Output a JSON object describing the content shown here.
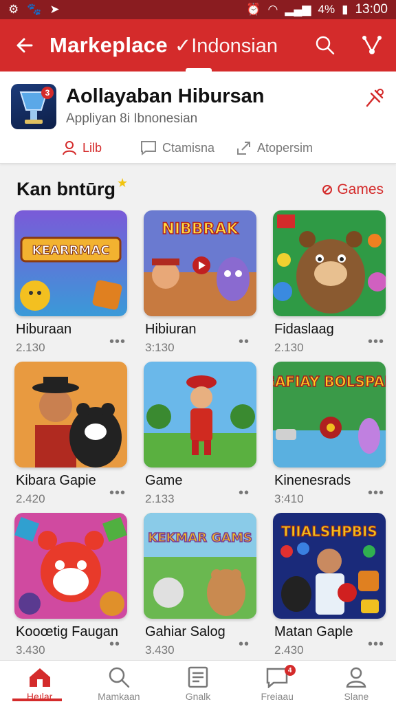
{
  "status_bar": {
    "battery": "4%",
    "time": "13:00"
  },
  "app_bar": {
    "title": "Markeplace",
    "subtitle": "✓Indonsian"
  },
  "header": {
    "app_name": "Aollayaban Hibursan",
    "app_sub": "Appliyan 8i Ibnonesian",
    "icon_badge": "3",
    "actions": [
      {
        "label": "Lilb"
      },
      {
        "label": "Ctamisna"
      },
      {
        "label": "Atopersim"
      }
    ]
  },
  "section": {
    "title": "Kan bntūrg",
    "link": "Games"
  },
  "tiles": [
    {
      "name": "Hiburaan",
      "count": "2.130",
      "art_text": "KEARRMAC"
    },
    {
      "name": "Hibiuran",
      "count": "3:130",
      "art_text": "NIBBRAK"
    },
    {
      "name": "Fidaslaag",
      "count": "2.130",
      "art_text": ""
    },
    {
      "name": "Kibara Gapie",
      "count": "2.420",
      "art_text": ""
    },
    {
      "name": "Game",
      "count": "2.133",
      "art_text": ""
    },
    {
      "name": "Kinenesrads",
      "count": "3:410",
      "art_text": "GAFIAY BOLSPAK"
    },
    {
      "name": "Kooœtig Faugan",
      "count": "3.430",
      "art_text": ""
    },
    {
      "name": "Gahiar Salog",
      "count": "3.430",
      "art_text": "KEKMAR GAMS"
    },
    {
      "name": "Matan Gaple",
      "count": "2.430",
      "art_text": "TIIALSHPBIS"
    }
  ],
  "bottom_nav": [
    {
      "label": "Heılar",
      "active": true
    },
    {
      "label": "Mamkaan"
    },
    {
      "label": "Gnalk"
    },
    {
      "label": "Freiaau",
      "badge": "4"
    },
    {
      "label": "Slane"
    }
  ],
  "colors": {
    "brand": "#d42b2b",
    "status_bar": "#8a1c20"
  }
}
